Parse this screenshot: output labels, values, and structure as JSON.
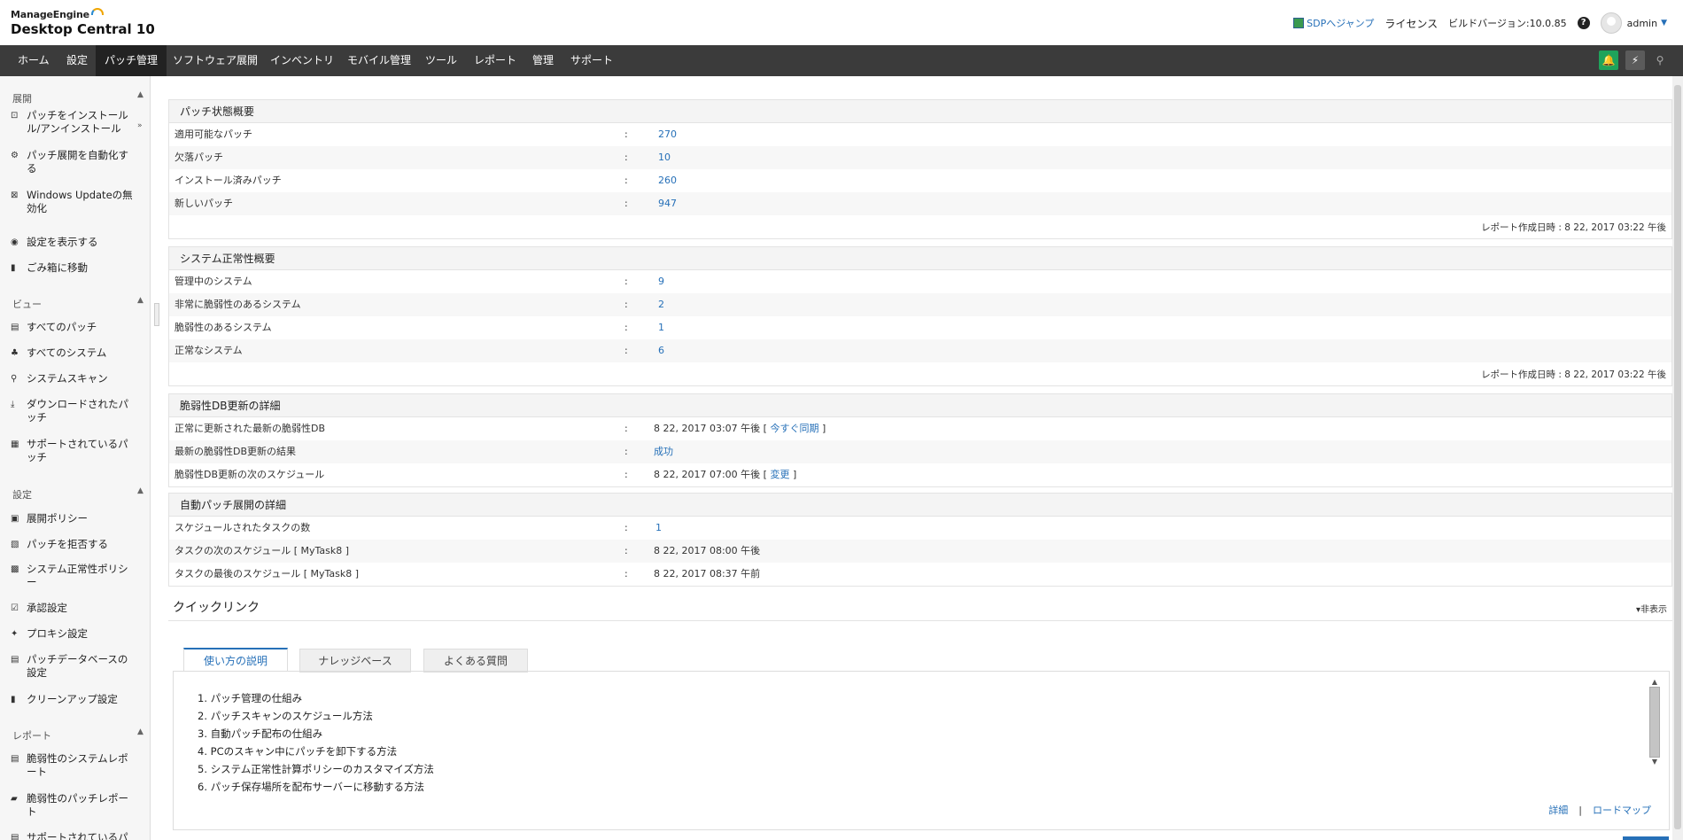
{
  "header": {
    "brand": "ManageEngine",
    "product": "Desktop Central 10",
    "sdp_link": "SDPへジャンプ",
    "license": "ライセンス",
    "build": "ビルドバージョン:10.0.85",
    "help": "?",
    "user": "admin"
  },
  "nav": {
    "items": [
      "ホーム",
      "設定",
      "パッチ管理",
      "ソフトウェア展開",
      "インベントリ",
      "モバイル管理",
      "ツール",
      "レポート",
      "管理",
      "サポート"
    ],
    "active": "パッチ管理"
  },
  "sidebar": {
    "sections": [
      {
        "title": "展開",
        "items": [
          "パッチをインストール/アンインストール",
          "パッチ展開を自動化する",
          "Windows Updateの無効化",
          "設定を表示する",
          "ごみ箱に移動"
        ]
      },
      {
        "title": "ビュー",
        "items": [
          "すべてのパッチ",
          "すべてのシステム",
          "システムスキャン",
          "ダウンロードされたパッチ",
          "サポートされているパッチ"
        ]
      },
      {
        "title": "設定",
        "items": [
          "展開ポリシー",
          "パッチを拒否する",
          "システム正常性ポリシー",
          "承認設定",
          "プロキシ設定",
          "パッチデータベースの設定",
          "クリーンアップ設定"
        ]
      },
      {
        "title": "レポート",
        "items": [
          "脆弱性のシステムレポート",
          "脆弱性のパッチレポート",
          "サポートされているパ"
        ]
      }
    ],
    "labels": {
      "s0": "展開",
      "s1": "ビュー",
      "s2": "設定",
      "s3": "レポート",
      "i0": "パッチをインストール",
      "i0b": "ル/アンインストール",
      "i1": "パッチ展開を自動化す",
      "i1b": "る",
      "i2": "Windows Updateの無",
      "i2b": "効化",
      "i3": "設定を表示する",
      "i4": "ごみ箱に移動",
      "i5": "すべてのパッチ",
      "i6": "すべてのシステム",
      "i7": "システムスキャン",
      "i8": "ダウンロードされたパ",
      "i8b": "ッチ",
      "i9": "サポートされているパ",
      "i9b": "ッチ",
      "i10": "展開ポリシー",
      "i11": "パッチを拒否する",
      "i12": "システム正常性ポリシ",
      "i12b": "ー",
      "i13": "承認設定",
      "i14": "プロキシ設定",
      "i15": "パッチデータベースの",
      "i15b": "設定",
      "i16": "クリーンアップ設定",
      "i17": "脆弱性のシステムレポ",
      "i17b": "ート",
      "i18": "脆弱性のパッチレポー",
      "i18b": "ト",
      "i19": "サポートされているパ"
    }
  },
  "patch_summary": {
    "title": "パッチ状態概要",
    "rows": [
      {
        "label": "適用可能なパッチ",
        "value": "270"
      },
      {
        "label": "欠落パッチ",
        "value": "10"
      },
      {
        "label": "インストール済みパッチ",
        "value": "260"
      },
      {
        "label": "新しいパッチ",
        "value": "947"
      }
    ],
    "report_time": "レポート作成日時 : 8 22, 2017 03:22 午後"
  },
  "health_summary": {
    "title": "システム正常性概要",
    "rows": [
      {
        "label": "管理中のシステム",
        "value": "9"
      },
      {
        "label": "非常に脆弱性のあるシステム",
        "value": "2"
      },
      {
        "label": "脆弱性のあるシステム",
        "value": "1"
      },
      {
        "label": "正常なシステム",
        "value": "6"
      }
    ],
    "report_time": "レポート作成日時 : 8 22, 2017 03:22 午後"
  },
  "vuln_db": {
    "title": "脆弱性DB更新の詳細",
    "rows": [
      {
        "label": "正常に更新された最新の脆弱性DB",
        "value": "8 22, 2017 03:07 午後 [",
        "link": "今すぐ同期",
        "tail": "]"
      },
      {
        "label": "最新の脆弱性DB更新の結果",
        "value": "成功"
      },
      {
        "label": "脆弱性DB更新の次のスケジュール",
        "value": "8 22, 2017 07:00 午後 [",
        "link": "変更",
        "tail": "]"
      }
    ]
  },
  "auto_deploy": {
    "title": "自動パッチ展開の詳細",
    "rows": [
      {
        "label": "スケジュールされたタスクの数",
        "value": "1"
      },
      {
        "label": "タスクの次のスケジュール [ MyTask8 ]",
        "value": "8 22, 2017 08:00 午後"
      },
      {
        "label": "タスクの最後のスケジュール [ MyTask8 ]",
        "value": "8 22, 2017 08:37 午前"
      }
    ]
  },
  "quick_links": {
    "title": "クイックリンク",
    "hide": "非表示",
    "tabs": [
      "使い方の説明",
      "ナレッジベース",
      "よくある質問"
    ],
    "howto": [
      "1. パッチ管理の仕組み",
      "2. パッチスキャンのスケジュール方法",
      "3. 自動パッチ配布の仕組み",
      "4. PCのスキャン中にパッチを卸下する方法",
      "5. システム正常性計算ポリシーのカスタマイズ方法",
      "6. パッチ保存場所を配布サーバーに移動する方法"
    ],
    "detail": "詳細",
    "roadmap": "ロードマップ"
  }
}
